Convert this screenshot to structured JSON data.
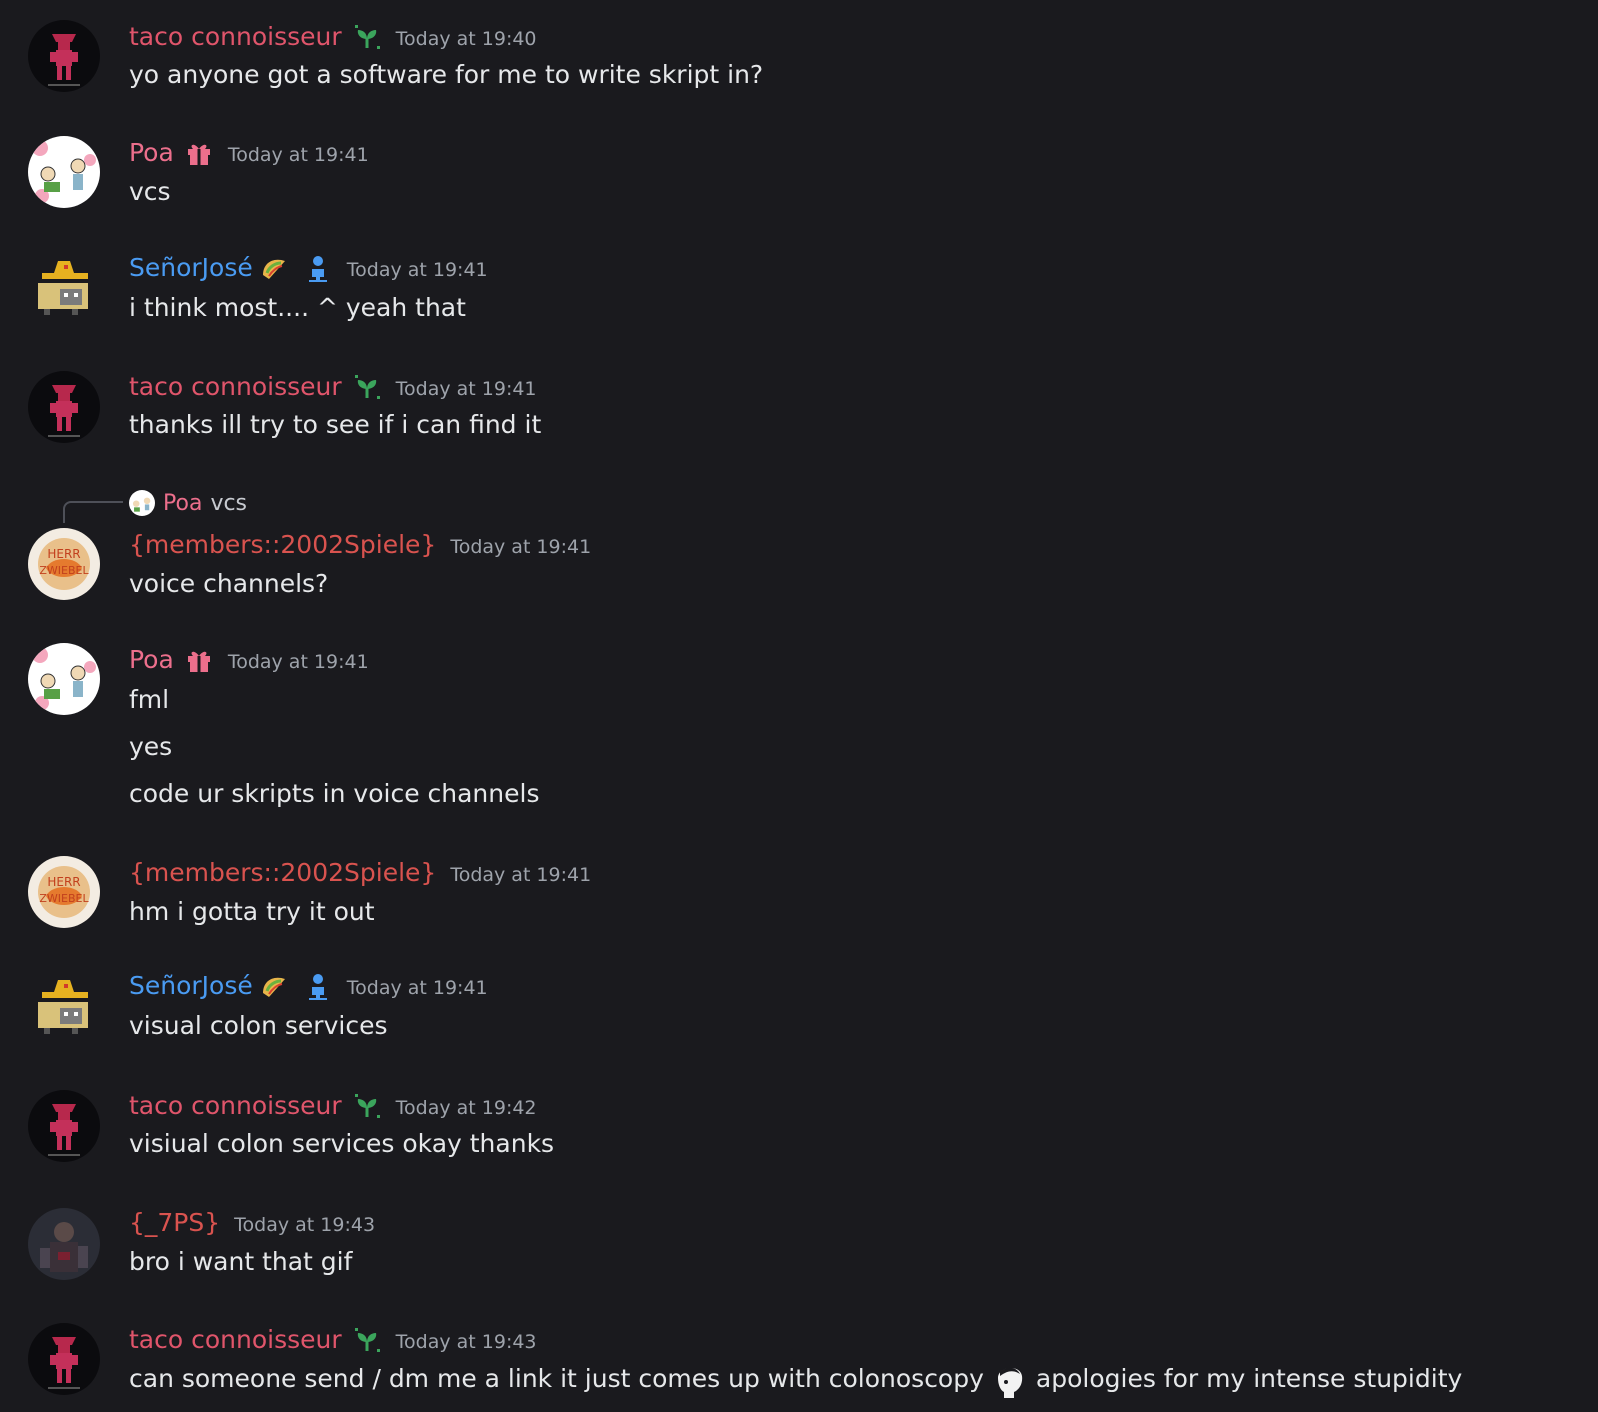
{
  "messages": [
    {
      "username": "taco connoisseur",
      "time": "Today at 19:40",
      "lines": [
        "yo anyone got a software for me to write skript in?"
      ]
    },
    {
      "username": "Poa",
      "time": "Today at 19:41",
      "lines": [
        "vcs"
      ]
    },
    {
      "username": "SeñorJosé",
      "time": "Today at 19:41",
      "lines": [
        "i think most.... ^ yeah that"
      ]
    },
    {
      "username": "taco connoisseur",
      "time": "Today at 19:41",
      "lines": [
        "thanks ill try to see if i can find it"
      ]
    },
    {
      "reply": {
        "username": "Poa",
        "text": "vcs"
      },
      "username": "{members::2002Spiele}",
      "time": "Today at 19:41",
      "lines": [
        "voice channels?"
      ]
    },
    {
      "username": "Poa",
      "time": "Today at 19:41",
      "lines": [
        "fml",
        "yes",
        "code ur skripts in voice channels"
      ]
    },
    {
      "username": "{members::2002Spiele}",
      "time": "Today at 19:41",
      "lines": [
        "hm i gotta try it out"
      ]
    },
    {
      "username": "SeñorJosé",
      "time": "Today at 19:41",
      "lines": [
        "visual colon services"
      ]
    },
    {
      "username": "taco connoisseur",
      "time": "Today at 19:42",
      "lines": [
        "visiual colon services okay thanks"
      ]
    },
    {
      "username": "{_7PS}",
      "time": "Today at 19:43",
      "lines": [
        "bro i want that gif"
      ]
    },
    {
      "username": "taco connoisseur",
      "time": "Today at 19:43",
      "lines_parts": [
        "can someone send / dm me a link it just comes up with colonoscopy",
        "apologies for my intense stupidity"
      ]
    }
  ],
  "colors": {
    "background": "#1a1a1e",
    "taco": "#e0556b",
    "poa": "#ec6f8c",
    "senor": "#4a9bf2",
    "members": "#d9534f",
    "timestamp": "#9ea3ab",
    "text": "#e6e8ea"
  },
  "icons": {
    "taco_badge": "sprout-icon",
    "poa_badge": "gift-icon",
    "senor_badges": [
      "taco-icon",
      "person-icon"
    ],
    "inline_emoji": "skull-face-icon"
  }
}
